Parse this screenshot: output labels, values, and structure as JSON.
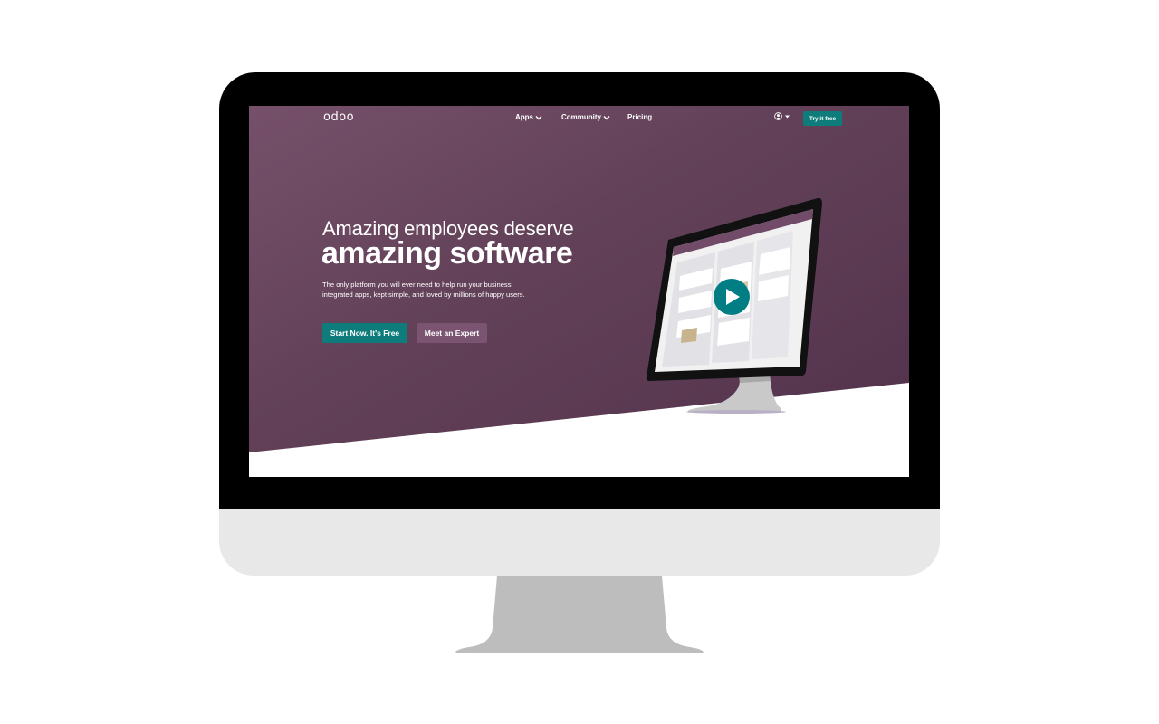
{
  "nav": {
    "logo": "odoo",
    "apps_label": "Apps",
    "community_label": "Community",
    "pricing_label": "Pricing",
    "try_label": "Try it free"
  },
  "hero": {
    "line1": "Amazing employees deserve",
    "line2": "amazing software",
    "subtitle_line1": "The only platform you will ever need to help run your business:",
    "subtitle_line2": "integrated apps, kept simple, and loved by millions of happy users.",
    "primary_button": "Start Now. It's Free",
    "secondary_button": "Meet an Expert"
  },
  "colors": {
    "brand_purple": "#714b67",
    "accent_teal": "#0e7c7b"
  },
  "icons": [
    "chevron-down-icon",
    "user-icon",
    "caret-down-icon",
    "play-icon"
  ]
}
